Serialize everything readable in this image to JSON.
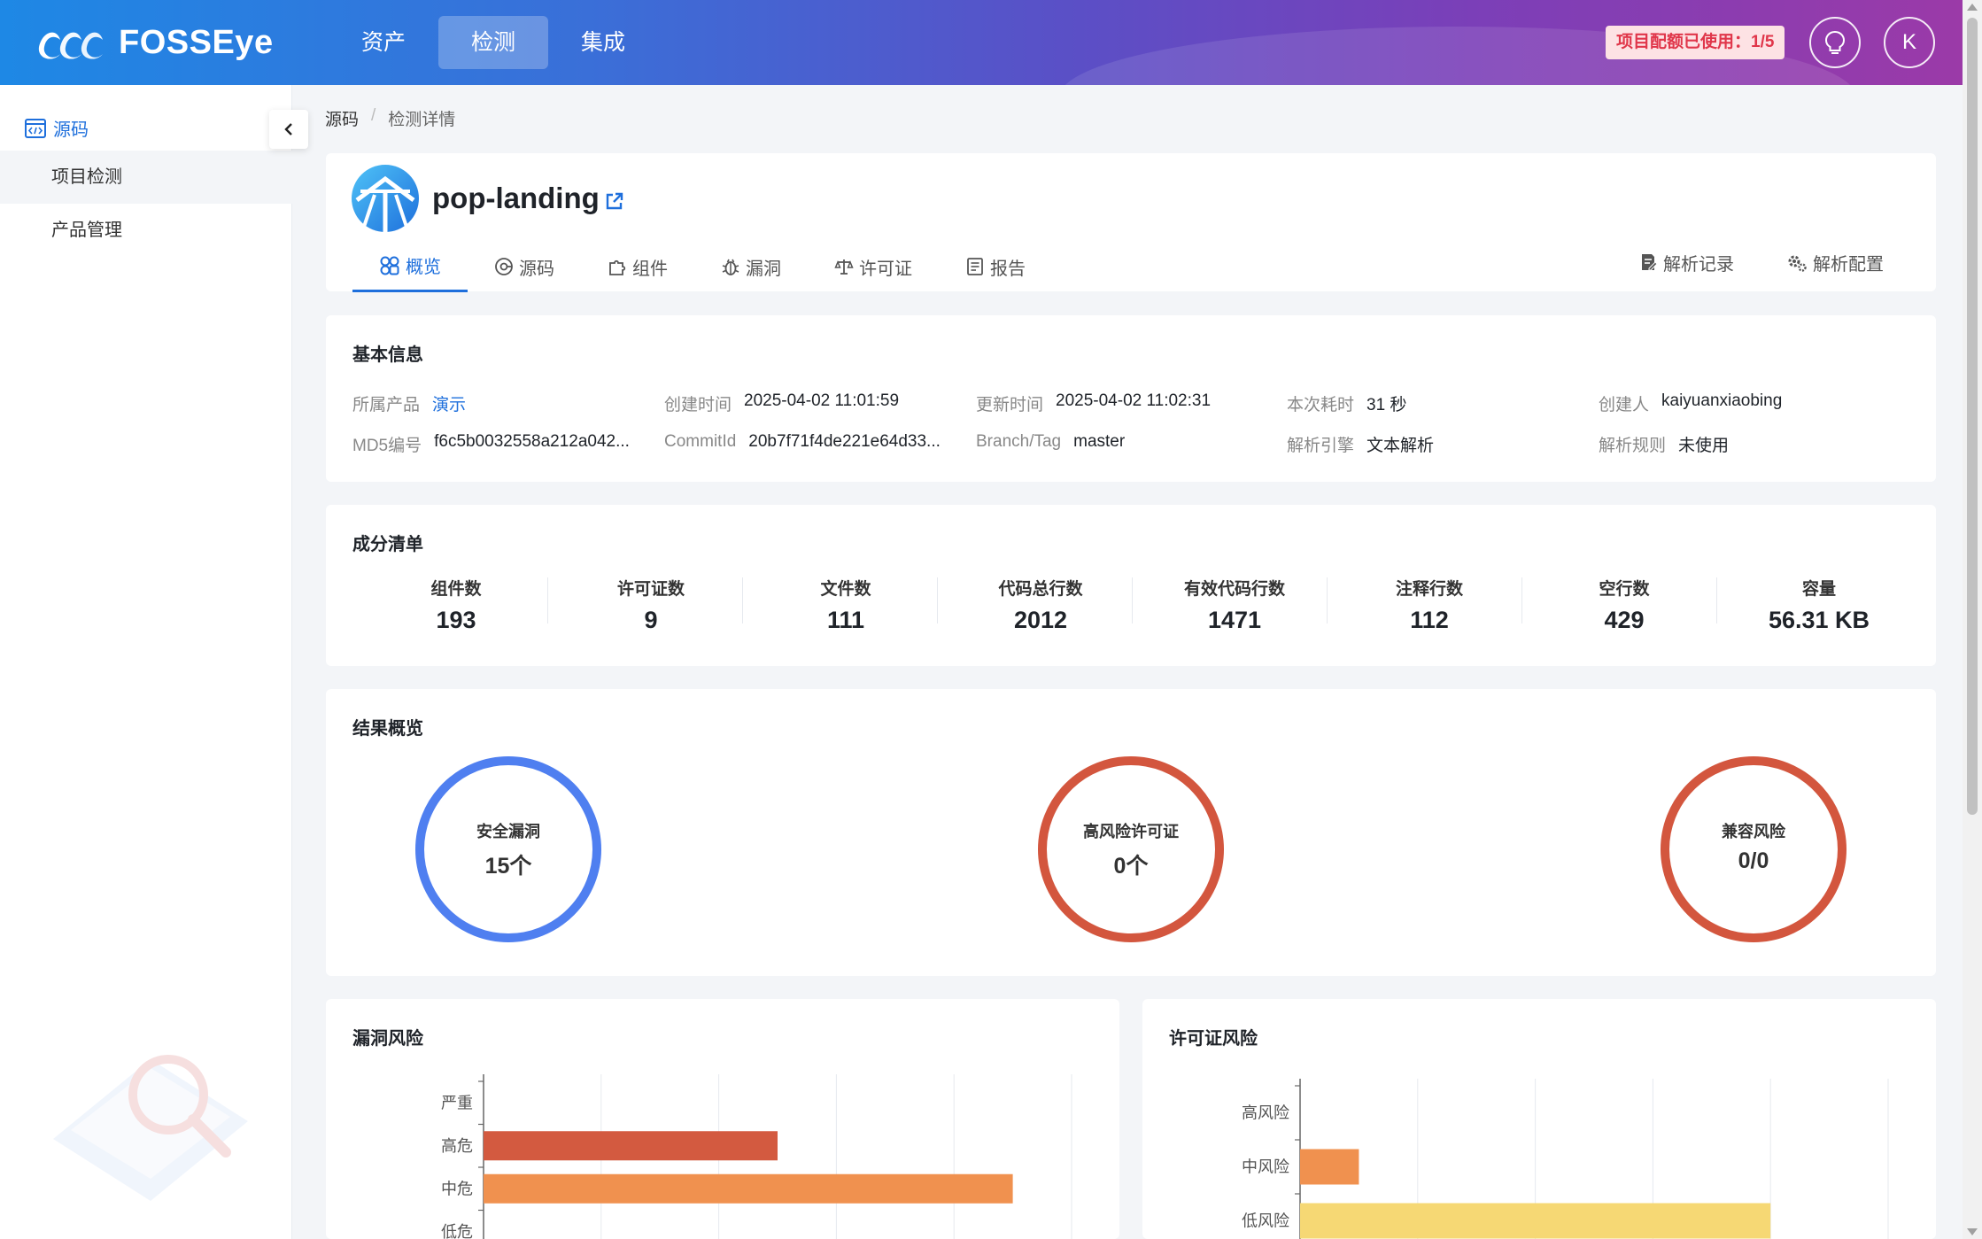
{
  "header": {
    "logo_text": "FOSSEye",
    "nav": [
      "资产",
      "检测",
      "集成"
    ],
    "quota": "项目配额已使用：1/5",
    "avatar_letter": "K"
  },
  "sidebar": {
    "root_label": "源码",
    "items": [
      "项目检测",
      "产品管理"
    ]
  },
  "breadcrumb": [
    "源码",
    "检测详情"
  ],
  "project": {
    "name": "pop-landing",
    "tabs": [
      "概览",
      "源码",
      "组件",
      "漏洞",
      "许可证",
      "报告"
    ],
    "right_tabs": [
      "解析记录",
      "解析配置"
    ]
  },
  "basic_info": {
    "title": "基本信息",
    "product_k": "所属产品",
    "product_v": "演示",
    "created_k": "创建时间",
    "created_v": "2025-04-02 11:01:59",
    "updated_k": "更新时间",
    "updated_v": "2025-04-02 11:02:31",
    "duration_k": "本次耗时",
    "duration_v": "31 秒",
    "creator_k": "创建人",
    "creator_v": "kaiyuanxiaobing",
    "md5_k": "MD5编号",
    "md5_v": "f6c5b0032558a212a042...",
    "commit_k": "CommitId",
    "commit_v": "20b7f71f4de221e64d33...",
    "branch_k": "Branch/Tag",
    "branch_v": "master",
    "engine_k": "解析引擎",
    "engine_v": "文本解析",
    "rule_k": "解析规则",
    "rule_v": "未使用"
  },
  "bill": {
    "title": "成分清单",
    "stats": [
      {
        "label": "组件数",
        "value": "193"
      },
      {
        "label": "许可证数",
        "value": "9"
      },
      {
        "label": "文件数",
        "value": "111"
      },
      {
        "label": "代码总行数",
        "value": "2012"
      },
      {
        "label": "有效代码行数",
        "value": "1471"
      },
      {
        "label": "注释行数",
        "value": "112"
      },
      {
        "label": "空行数",
        "value": "429"
      },
      {
        "label": "容量",
        "value": "56.31 KB"
      }
    ]
  },
  "results": {
    "title": "结果概览",
    "rings": [
      {
        "label": "安全漏洞",
        "value": "15个",
        "color": "#4f7ff0"
      },
      {
        "label": "高风险许可证",
        "value": "0个",
        "color": "#d3563e"
      },
      {
        "label": "兼容风险",
        "value": "0/0",
        "color": "#d3563e"
      }
    ]
  },
  "vuln_risk": {
    "title": "漏洞风险"
  },
  "license_risk": {
    "title": "许可证风险"
  },
  "chart_data": [
    {
      "type": "bar",
      "orientation": "horizontal",
      "title": "漏洞风险",
      "categories": [
        "严重",
        "高危",
        "中危",
        "低危"
      ],
      "values": [
        0,
        5,
        9,
        0
      ],
      "colors": [
        "#d35a40",
        "#d35a40",
        "#f0914f",
        "#f0914f"
      ],
      "xlim": [
        0,
        10
      ],
      "grid": true
    },
    {
      "type": "bar",
      "orientation": "horizontal",
      "title": "许可证风险",
      "categories": [
        "高风险",
        "中风险",
        "低风险"
      ],
      "values": [
        0,
        1,
        8
      ],
      "colors": [
        "#d35a40",
        "#f0914f",
        "#f6d874"
      ],
      "xlim": [
        0,
        10
      ],
      "grid": true
    }
  ]
}
